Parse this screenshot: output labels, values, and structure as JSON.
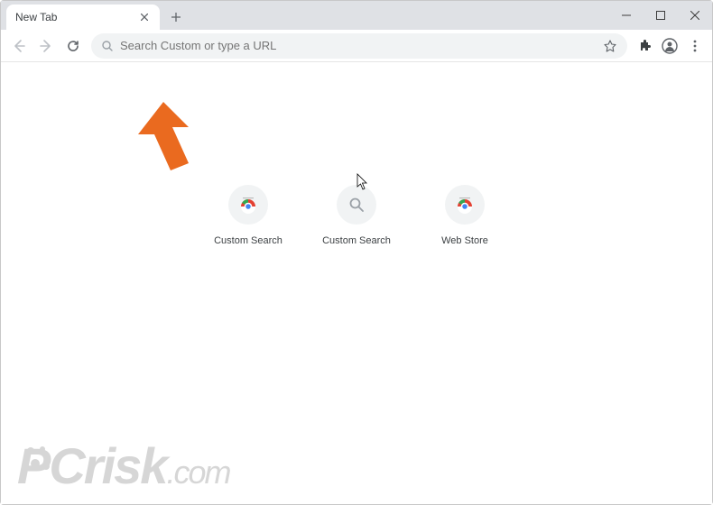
{
  "window": {
    "controls": {
      "minimize": "–",
      "maximize": "▢",
      "close": "×"
    }
  },
  "tabs": {
    "active": {
      "title": "New Tab"
    },
    "new_tab_tooltip": "New tab"
  },
  "toolbar": {
    "omnibox_placeholder": "Search Custom or type a URL"
  },
  "shortcuts": [
    {
      "label": "Custom Search",
      "icon": "chrome-icon"
    },
    {
      "label": "Custom Search",
      "icon": "search-icon"
    },
    {
      "label": "Web Store",
      "icon": "chrome-icon"
    }
  ],
  "watermark": {
    "text_prefix": "PC",
    "text_suffix": "risk",
    "tld": ".com"
  },
  "annotation_arrow_color": "#ea6a1f"
}
